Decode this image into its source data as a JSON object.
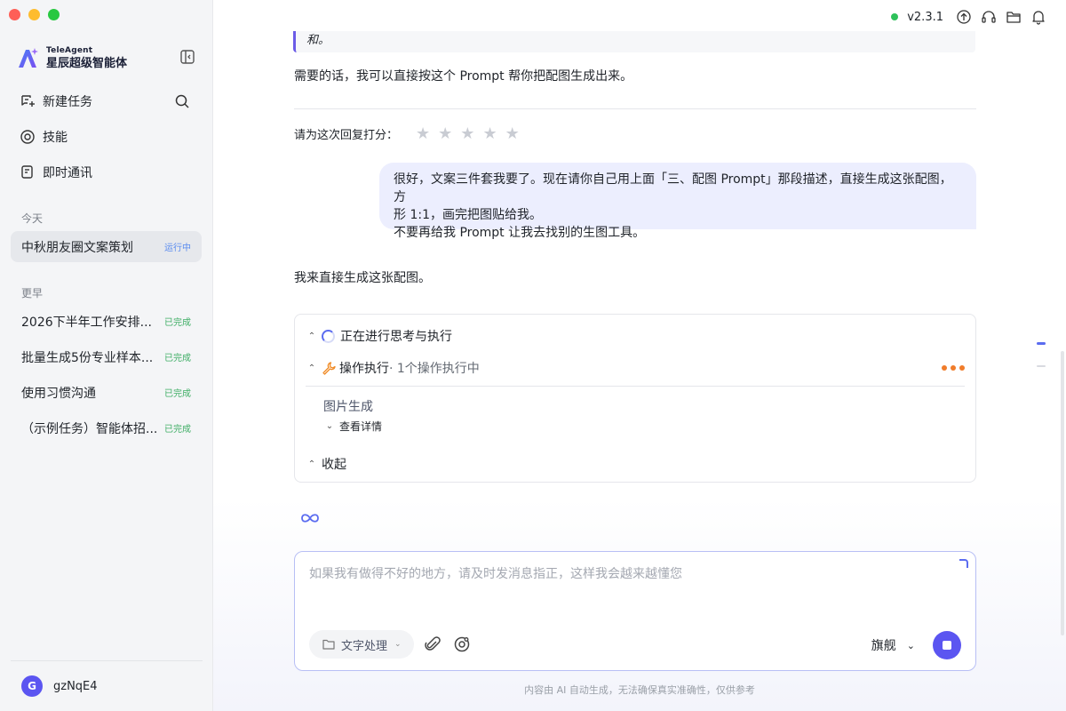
{
  "sidebar": {
    "brand_en": "TeleAgent",
    "brand_cn": "星辰超级智能体",
    "nav": [
      {
        "label": "新建任务"
      },
      {
        "label": "技能"
      },
      {
        "label": "即时通讯"
      }
    ],
    "today_label": "今天",
    "today_tasks": [
      {
        "title": "中秋朋友圈文案策划",
        "status": "运行中"
      }
    ],
    "earlier_label": "更早",
    "earlier_tasks": [
      {
        "title": "2026下半年工作安排...",
        "status": "已完成"
      },
      {
        "title": "批量生成5份专业样本...",
        "status": "已完成"
      },
      {
        "title": "使用习惯沟通",
        "status": "已完成"
      },
      {
        "title": "（示例任务）智能体招...",
        "status": "已完成"
      }
    ],
    "user": {
      "initial": "G",
      "name": "gzNqE4"
    }
  },
  "topbar": {
    "version": "v2.3.1",
    "icons": [
      "upload-icon",
      "headset-icon",
      "folder-icon",
      "bell-icon"
    ]
  },
  "chat": {
    "quote_tail": "和。",
    "assistant_followup": "需要的话，我可以直接按这个 Prompt 帮你把配图生成出来。",
    "rating_label": "请为这次回复打分：",
    "rating_stars": 5,
    "user_message_line1": "很好，文案三件套我要了。现在请你自己用上面「三、配图 Prompt」那段描述，直接生成这张配图，方",
    "user_message_line2": "形 1:1，画完把图贴给我。",
    "user_message_line3": "不要再给我 Prompt 让我去找别的生图工具。",
    "assistant_reply": "我来直接生成这张配图。",
    "exec": {
      "thinking": "正在进行思考与执行",
      "op_title": "操作执行",
      "op_sub": " · 1个操作执行中",
      "tool_name": "图片生成",
      "view_detail": "查看详情",
      "collapse": "收起"
    }
  },
  "composer": {
    "placeholder": "如果我有做得不好的地方，请及时发消息指正，这样我会越来越懂您",
    "tool_pill": "文字处理",
    "model": "旗舰"
  },
  "disclaimer": "内容由 AI 自动生成，无法确保真实准确性，仅供参考",
  "colors": {
    "accent": "#5b55f1",
    "running": "#5a8bef",
    "done": "#3fae66",
    "online": "#2ec15a",
    "busy_dots": "#f07c2a"
  }
}
